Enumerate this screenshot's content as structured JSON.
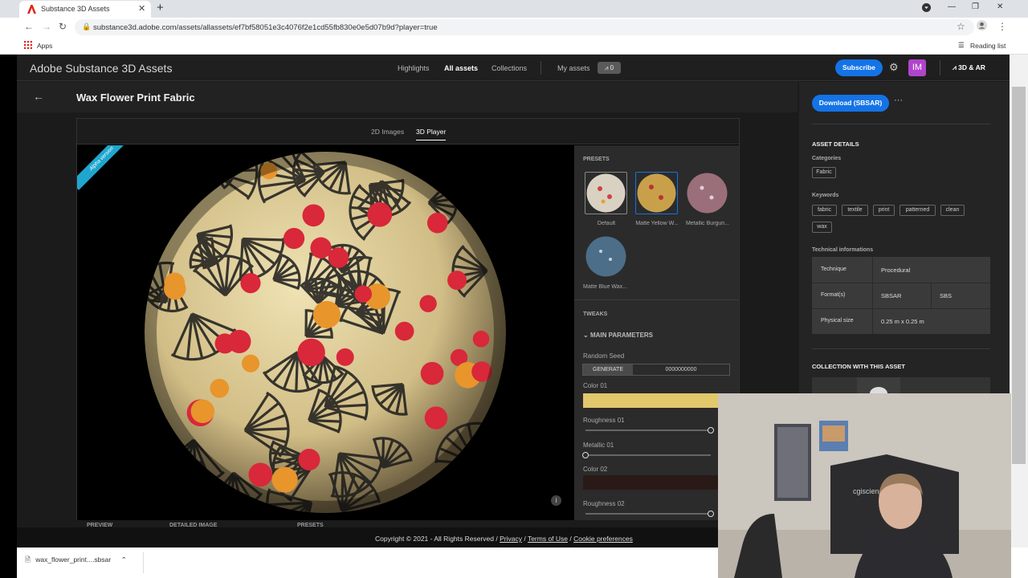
{
  "browser": {
    "tab_title": "Substance 3D Assets",
    "url": "substance3d.adobe.com/assets/allassets/ef7bf58051e3c4076f2e1cd55fb830e0e5d07b9d?player=true",
    "apps_label": "Apps",
    "reading_list_label": "Reading list"
  },
  "nav": {
    "brand": "Adobe Substance 3D Assets",
    "highlights": "Highlights",
    "all_assets": "All assets",
    "collections": "Collections",
    "my_assets": "My assets",
    "cart_count": "0",
    "subscribe": "Subscribe",
    "avatar": "IM",
    "ar_label": "3D & AR"
  },
  "asset": {
    "title": "Wax Flower Print Fabric"
  },
  "viewer": {
    "tab_images": "2D Images",
    "tab_player": "3D Player",
    "alpha_badge": "Alpha version",
    "info_icon": "i"
  },
  "panel": {
    "presets_heading": "PRESETS",
    "presets": [
      {
        "label": "Default",
        "color": "#d9d2c2"
      },
      {
        "label": "Matte Yellow W...",
        "color": "#c9a04a"
      },
      {
        "label": "Metallic Burgun...",
        "color": "#9a6f7a"
      },
      {
        "label": "Matte Blue Wax...",
        "color": "#4c6e88"
      }
    ],
    "tweaks_heading": "TWEAKS",
    "main_params": "MAIN PARAMETERS",
    "random_seed_label": "Random Seed",
    "generate_label": "GENERATE",
    "seed_value": "0000000000",
    "color01_label": "Color 01",
    "color01_value": "#e2c76c",
    "roughness01_label": "Roughness 01",
    "roughness01": 1.0,
    "metallic01_label": "Metallic 01",
    "metallic01": 0.0,
    "color02_label": "Color 02",
    "color02_value": "#2a1a17",
    "roughness02_label": "Roughness 02",
    "roughness02": 1.0
  },
  "bottom_tabs": [
    "PREVIEW",
    "DETAILED IMAGE",
    "PRESETS"
  ],
  "sidebar": {
    "download_label": "Download (SBSAR)",
    "more_label": "···",
    "asset_details": "ASSET DETAILS",
    "categories_label": "Categories",
    "categories": [
      "Fabric"
    ],
    "keywords_label": "Keywords",
    "keywords": [
      "fabric",
      "textile",
      "print",
      "patterned",
      "clean",
      "wax"
    ],
    "tech_label": "Technical informations",
    "technique_label": "Technique",
    "technique_value": "Procedural",
    "formats_label": "Format(s)",
    "format1": "SBSAR",
    "format2": "SBS",
    "size_label": "Physical size",
    "size_value": "0.25 m x 0.25 m",
    "collection_heading": "COLLECTION WITH THIS ASSET"
  },
  "footer": {
    "copyright": "Copyright © 2021 - All Rights Reserved",
    "privacy": "Privacy",
    "terms": "Terms of Use",
    "cookies": "Cookie preferences"
  },
  "download_bar": {
    "file": "wax_flower_print....sbsar"
  },
  "webcam": {
    "poster_text": "cgiscience"
  }
}
